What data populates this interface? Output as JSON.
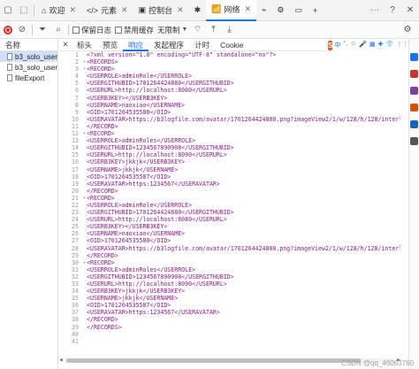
{
  "tabbar": {
    "tabs": [
      {
        "icon": "home-icon",
        "glyph": "⌂",
        "label": "欢迎"
      },
      {
        "icon": "code-icon",
        "glyph": "</>",
        "label": "元素"
      },
      {
        "icon": "console-icon",
        "glyph": "▣",
        "label": "控制台"
      },
      {
        "icon": "bug-icon",
        "glyph": "✱",
        "label": ""
      },
      {
        "icon": "wifi-icon",
        "glyph": "📶",
        "label": "网络",
        "active": true
      },
      {
        "icon": "performance-icon",
        "glyph": "⌁",
        "label": ""
      },
      {
        "icon": "memory-icon",
        "glyph": "⚙",
        "label": ""
      },
      {
        "icon": "application-icon",
        "glyph": "▭",
        "label": ""
      }
    ],
    "add_label": "+",
    "more_label": "···",
    "help_label": "?",
    "close_label": "✕"
  },
  "toolbar": {
    "preserve_log": "保留日志",
    "disable_cache": "禁用缓存",
    "throttle": "无限制"
  },
  "left_panel": {
    "header": "名称",
    "items": [
      {
        "name": "b3_solo_user",
        "selected": true
      },
      {
        "name": "b3_solo_user",
        "selected": false
      },
      {
        "name": "fileExport",
        "selected": false
      }
    ]
  },
  "detail_tabs": {
    "close": "✕",
    "tabs": [
      "标头",
      "预览",
      "响应",
      "发起程序",
      "计时",
      "Cookie"
    ],
    "active_index": 2
  },
  "ime": {
    "logo": "S",
    "items": [
      "中",
      "°,",
      "☺",
      "🎤",
      "▦",
      "✚",
      "👕",
      "⋮⋮"
    ]
  },
  "code_lines": [
    {
      "n": "1",
      "text": "<?xml version=\"1.0\" encoding=\"UTF-8\" standalone=\"no\"?>"
    },
    {
      "n": "2",
      "text": "<RECORDS>"
    },
    {
      "n": "3",
      "text": "<RECORD>"
    },
    {
      "n": "4",
      "text": "<USERROLE>adminRole</USERROLE>"
    },
    {
      "n": "5",
      "text": "<USERGITHUBID>1701264424880</USERGITHUBID>"
    },
    {
      "n": "6",
      "text": "<USERURL>http://localhost:8080</USERURL>"
    },
    {
      "n": "7",
      "text": "<USERB3KEY></USERB3KEY>"
    },
    {
      "n": "8",
      "text": "<USERNAME>naoxiao</USERNAME>"
    },
    {
      "n": "9",
      "text": "<OID>1701264535580</OID>"
    },
    {
      "n": "10",
      "text": "<USERAVATAR>https://b3logfile.com/avatar/1701264424880.png?imageView2/1/w/128/h/128/interla"
    },
    {
      "n": "11",
      "text": "</RECORD>"
    },
    {
      "n": "12",
      "text": "<RECORD>"
    },
    {
      "n": "13",
      "text": "<USERROLE>adminRoles</USERROLE>"
    },
    {
      "n": "14",
      "text": "<USERGITHUBID>1234567890908</USERGITHUBID>"
    },
    {
      "n": "15",
      "text": "<USERURL>http://localhost:8090</USERURL>"
    },
    {
      "n": "16",
      "text": "<USERB3KEY>jkkjk</USERB3KEY>"
    },
    {
      "n": "17",
      "text": "<USERNAME>jkkjk</USERNAME>"
    },
    {
      "n": "18",
      "text": "<OID>1701264535587</OID>"
    },
    {
      "n": "19",
      "text": "<USERAVATAR>https:1234567</USERAVATAR>"
    },
    {
      "n": "20",
      "text": "</RECORD>"
    },
    {
      "n": "21",
      "text": "<RECORD>"
    },
    {
      "n": "22",
      "text": "<USERROLE>adminRole</USERROLE>"
    },
    {
      "n": "23",
      "text": "<USERGITHUBID>1701264424880</USERGITHUBID>"
    },
    {
      "n": "24",
      "text": "<USERURL>http://localhost:8080</USERURL>"
    },
    {
      "n": "25",
      "text": "<USERB3KEY></USERB3KEY>"
    },
    {
      "n": "26",
      "text": "<USERNAME>naoxiao</USERNAME>"
    },
    {
      "n": "27",
      "text": "<OID>1701264535580</OID>"
    },
    {
      "n": "28",
      "text": "<USERAVATAR>https://b3logfile.com/avatar/1701264424880.png?imageView2/1/w/128/h/128/interla"
    },
    {
      "n": "29",
      "text": "</RECORD>"
    },
    {
      "n": "30",
      "text": "<RECORD>"
    },
    {
      "n": "31",
      "text": "<USERROLE>adminRoles</USERROLE>"
    },
    {
      "n": "32",
      "text": "<USERGITHUBID>1234567890908</USERGITHUBID>"
    },
    {
      "n": "33",
      "text": "<USERURL>http://localhost:8090</USERURL>"
    },
    {
      "n": "34",
      "text": "<USERB3KEY>jkkjk</USERB3KEY>"
    },
    {
      "n": "35",
      "text": "<USERNAME>jkkjk</USERNAME>"
    },
    {
      "n": "36",
      "text": "<OID>1701264535587</OID>"
    },
    {
      "n": "37",
      "text": "<USERAVATAR>https:1234567</USERAVATAR>"
    },
    {
      "n": "38",
      "text": "</RECORD>"
    },
    {
      "n": "39",
      "text": "</RECORDS>"
    },
    {
      "n": "40",
      "text": ""
    },
    {
      "n": "41",
      "text": ""
    }
  ],
  "fold_lines": [
    "2",
    "3",
    "12",
    "21",
    "30"
  ],
  "scroll": {
    "thumb_fraction": 0.9
  },
  "watermark": "CSDN @qq_46063760",
  "colors": {
    "accent": "#1a73e8",
    "tag": "#8b1a8b",
    "record": "#d93025"
  }
}
